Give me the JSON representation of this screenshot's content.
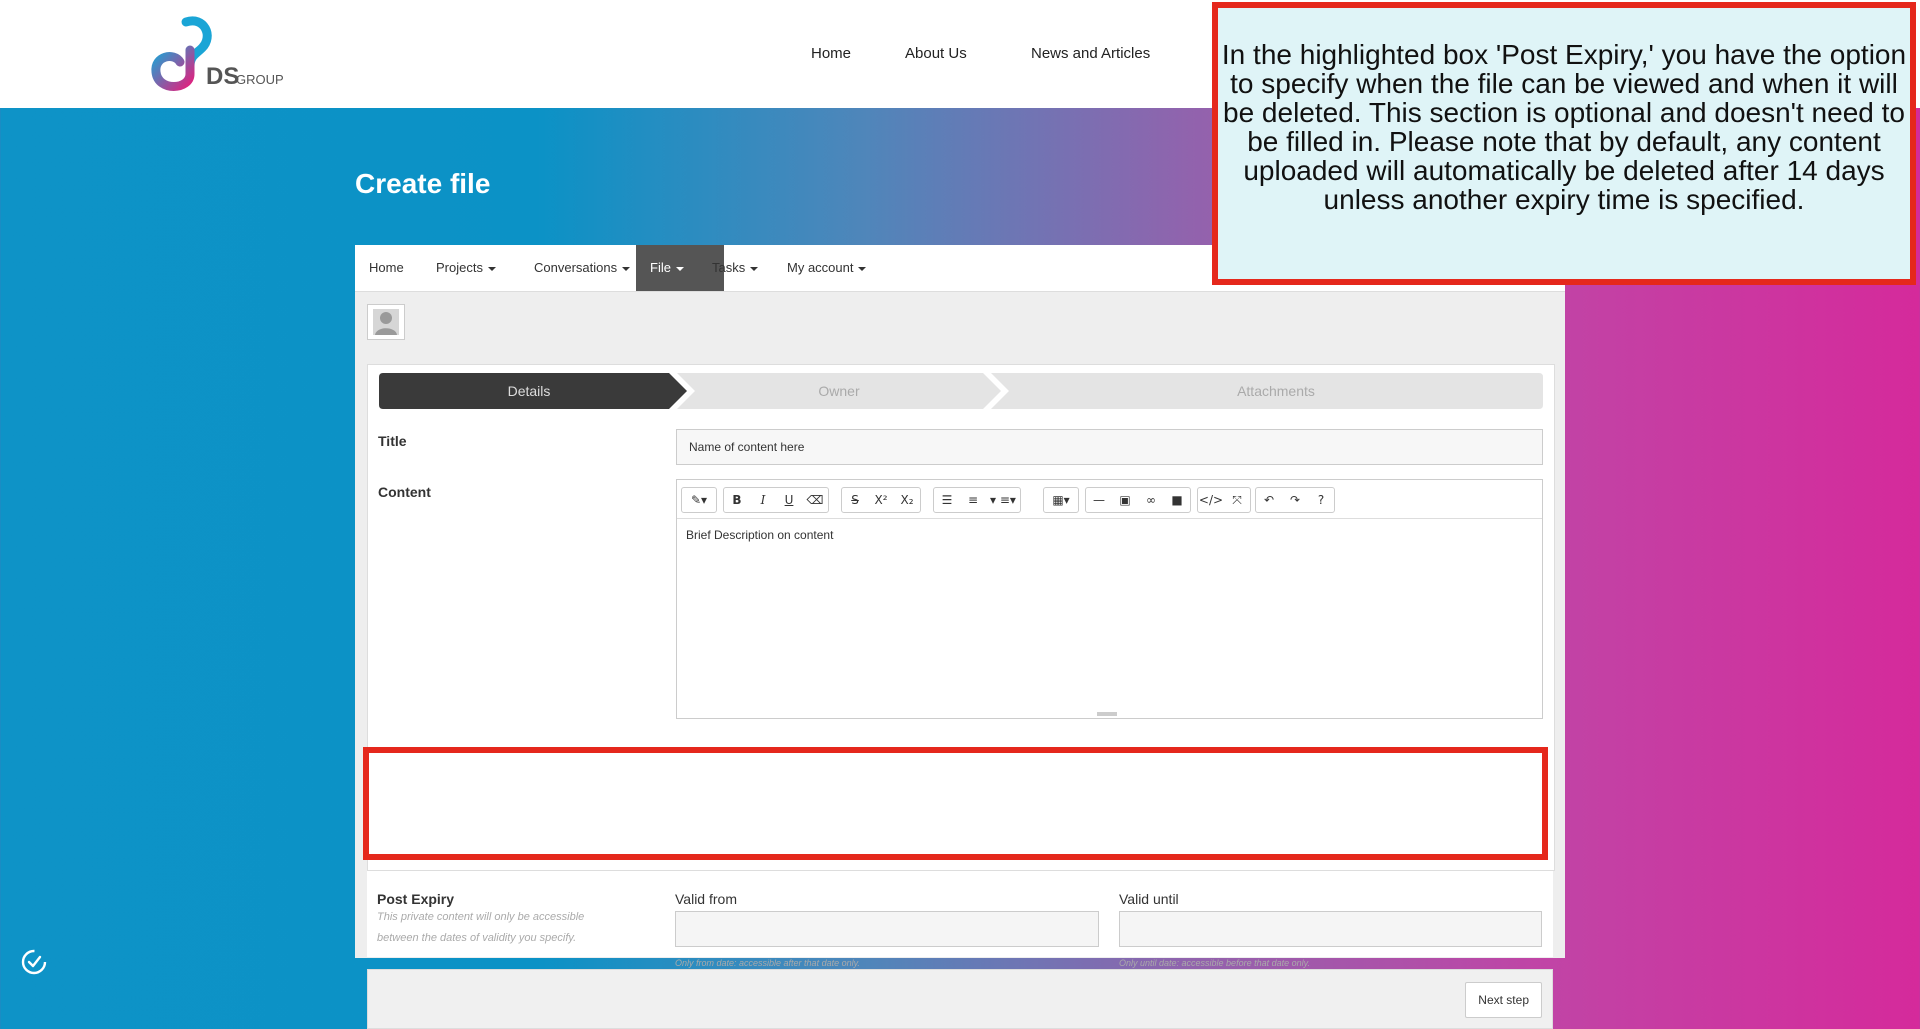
{
  "header": {
    "logo_text": "DS",
    "logo_subtext": "GROUP",
    "nav": [
      "Home",
      "About Us",
      "News and Articles"
    ]
  },
  "page": {
    "title": "Create file"
  },
  "app_menu": {
    "items": [
      {
        "label": "Home",
        "dropdown": false
      },
      {
        "label": "Projects",
        "dropdown": true
      },
      {
        "label": "Conversations",
        "dropdown": true
      },
      {
        "label": "File",
        "dropdown": true,
        "active": true
      },
      {
        "label": "Tasks",
        "dropdown": true
      },
      {
        "label": "My account",
        "dropdown": true
      }
    ]
  },
  "wizard": {
    "steps": [
      "Details",
      "Owner",
      "Attachments"
    ],
    "active_step": "Details"
  },
  "form": {
    "title_label": "Title",
    "title_value": "Name of content here",
    "content_label": "Content",
    "content_value": "Brief Description on content",
    "toolbar_icons": [
      "magic-wand-icon",
      "bold-icon",
      "italic-icon",
      "underline-icon",
      "eraser-icon",
      "strikethrough-icon",
      "superscript-icon",
      "subscript-icon",
      "bullet-list-icon",
      "numbered-list-icon",
      "align-icon",
      "table-icon",
      "horizontal-rule-icon",
      "image-icon",
      "link-icon",
      "video-icon",
      "code-view-icon",
      "fullscreen-icon",
      "undo-icon",
      "redo-icon",
      "help-icon"
    ]
  },
  "expiry": {
    "label": "Post Expiry",
    "description": "This private content will only be accessible between the dates of validity you specify.",
    "valid_from_label": "Valid from",
    "valid_from_value": "",
    "valid_from_hint": "Only from date: accessible after that date only.",
    "valid_until_label": "Valid until",
    "valid_until_value": "",
    "valid_until_hint": "Only until date: accessible before that date only."
  },
  "footer": {
    "next_label": "Next step"
  },
  "callout": {
    "text": "In the highlighted box 'Post Expiry,' you have the option to specify when the file can be viewed and when it will be deleted. This section is optional and doesn't need to be filled in. Please note that by default, any content uploaded will automatically be deleted after 14 days unless another expiry time is specified."
  },
  "colors": {
    "highlight": "#e5281c",
    "callout_bg": "#dff4f7",
    "active_menu": "#555555",
    "active_step": "#3a3a3a"
  }
}
